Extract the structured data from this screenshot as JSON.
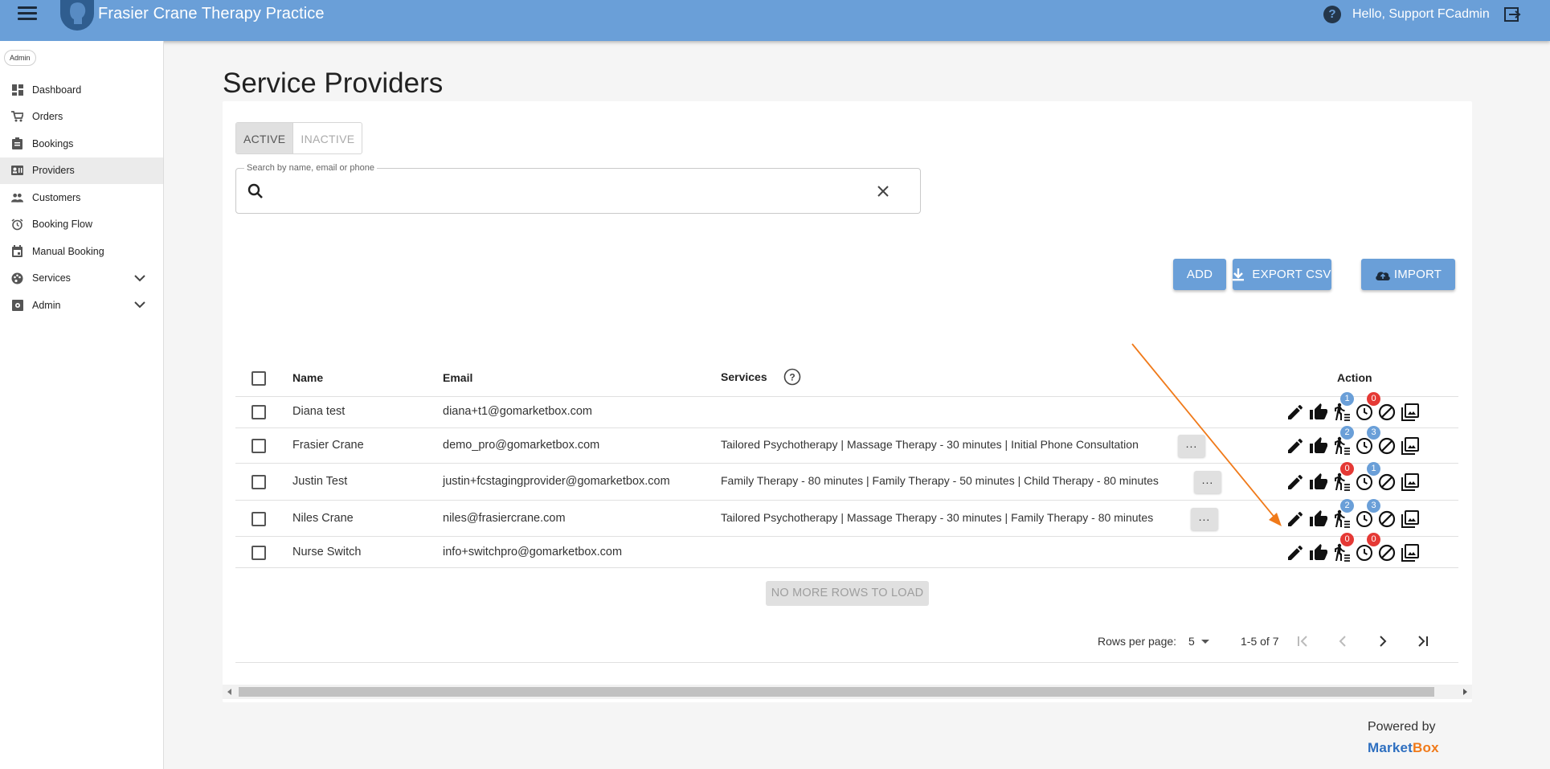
{
  "app": {
    "title": "Frasier Crane Therapy Practice",
    "greeting": "Hello, Support FCadmin"
  },
  "sidebar": {
    "role": "Admin",
    "items": [
      {
        "label": "Dashboard",
        "icon": "dashboard-icon"
      },
      {
        "label": "Orders",
        "icon": "cart-icon"
      },
      {
        "label": "Bookings",
        "icon": "clipboard-icon"
      },
      {
        "label": "Providers",
        "icon": "provider-card-icon",
        "active": true
      },
      {
        "label": "Customers",
        "icon": "people-icon"
      },
      {
        "label": "Booking Flow",
        "icon": "alarm-icon"
      },
      {
        "label": "Manual Booking",
        "icon": "calendar-icon"
      },
      {
        "label": "Services",
        "icon": "palette-icon",
        "expandable": true
      },
      {
        "label": "Admin",
        "icon": "settings-box-icon",
        "expandable": true
      }
    ]
  },
  "page": {
    "title": "Service Providers",
    "tabs": [
      {
        "label": "ACTIVE",
        "active": true
      },
      {
        "label": "INACTIVE"
      }
    ],
    "search": {
      "label": "Search by name, email or phone",
      "value": ""
    },
    "buttons": {
      "add": "ADD",
      "export": "EXPORT CSV",
      "import": "IMPORT"
    }
  },
  "table": {
    "columns": {
      "name": "Name",
      "email": "Email",
      "services": "Services",
      "action": "Action"
    },
    "rows": [
      {
        "name": "Diana test",
        "email": "diana+t1@gomarketbox.com",
        "services": "",
        "more": "",
        "badge_blue": "1",
        "badge_red": "0",
        "badge_red_left": "",
        "badge_blue_right": ""
      },
      {
        "name": "Frasier Crane",
        "email": "demo_pro@gomarketbox.com",
        "services": "Tailored Psychotherapy | Massage Therapy - 30 minutes | Initial Phone Consultation",
        "more": "...",
        "badge_blue": "2",
        "badge_red": "",
        "badge_red_left": "",
        "badge_blue_right": "3"
      },
      {
        "name": "Justin Test",
        "email": "justin+fcstagingprovider@gomarketbox.com",
        "services": "Family Therapy - 80 minutes | Family Therapy - 50 minutes | Child Therapy - 80 minutes",
        "more": "...",
        "badge_blue": "",
        "badge_red": "",
        "badge_red_left": "0",
        "badge_blue_right": "1"
      },
      {
        "name": "Niles Crane",
        "email": "niles@frasiercrane.com",
        "services": "Tailored Psychotherapy | Massage Therapy - 30 minutes | Family Therapy - 80 minutes",
        "more": "...",
        "badge_blue": "2",
        "badge_red": "",
        "badge_red_left": "",
        "badge_blue_right": "3"
      },
      {
        "name": "Nurse Switch",
        "email": "info+switchpro@gomarketbox.com",
        "services": "",
        "more": "",
        "badge_blue": "",
        "badge_red": "0",
        "badge_red_left": "0",
        "badge_blue_right": ""
      }
    ],
    "no_more": "NO MORE ROWS TO LOAD"
  },
  "pagination": {
    "rows_per_page_label": "Rows per page:",
    "rows_per_page": "5",
    "range": "1-5 of 7"
  },
  "footer": {
    "powered_by": "Powered by",
    "brand_part1": "Market",
    "brand_part2": "Box"
  },
  "colors": {
    "header": "#6a9fd8",
    "badge_blue": "#6a9fd8",
    "badge_red": "#e53935",
    "annotation_arrow": "#f07a1a"
  }
}
